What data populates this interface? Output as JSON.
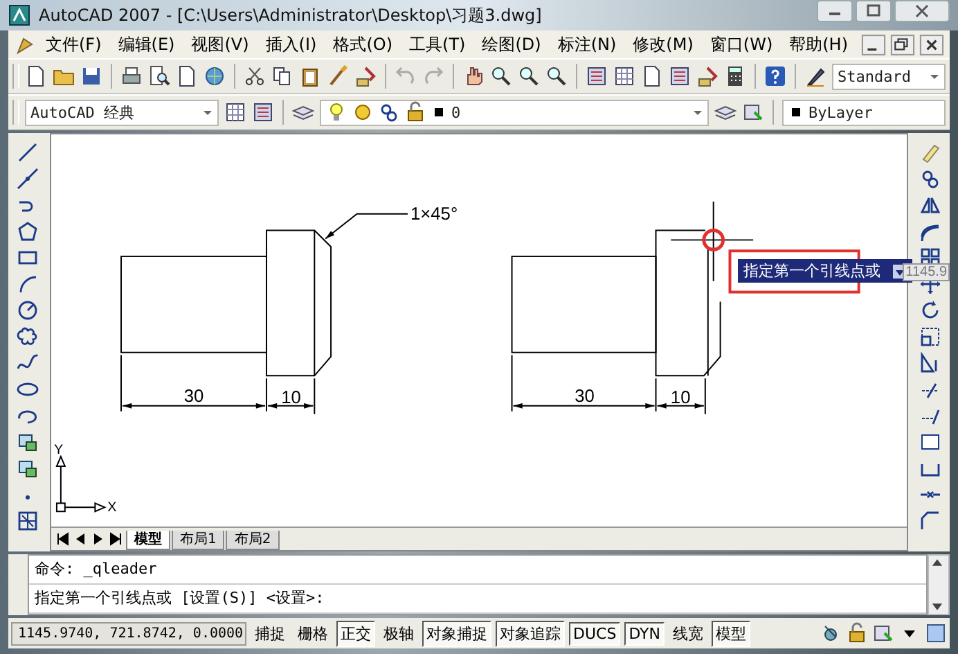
{
  "window": {
    "title": "AutoCAD 2007 - [C:\\Users\\Administrator\\Desktop\\习题3.dwg]"
  },
  "menu": [
    "文件(F)",
    "编辑(E)",
    "视图(V)",
    "插入(I)",
    "格式(O)",
    "工具(T)",
    "绘图(D)",
    "标注(N)",
    "修改(M)",
    "窗口(W)",
    "帮助(H)"
  ],
  "toolbar": {
    "text_style": "Standard"
  },
  "properties_bar": {
    "workspace": "AutoCAD 经典",
    "layer": "0",
    "color_setting": "ByLayer"
  },
  "drawing": {
    "left_part": {
      "length_dim": "30",
      "head_dim": "10",
      "chamfer_note": "1×45°"
    },
    "right_part": {
      "length_dim": "30",
      "head_dim": "10"
    },
    "prompt_tooltip": "指定第一个引线点或",
    "coordinate_tooltip": "1145.9",
    "ucs_y": "Y",
    "ucs_x": "X"
  },
  "layout_tabs": [
    {
      "label": "模型",
      "selected": true
    },
    {
      "label": "布局1",
      "selected": false
    },
    {
      "label": "布局2",
      "selected": false
    }
  ],
  "command_lines": [
    "命令: _qleader",
    "指定第一个引线点或 [设置(S)] <设置>:"
  ],
  "status_bar": {
    "coordinates": "1145.9740, 721.8742, 0.0000",
    "toggles": [
      {
        "label": "捕捉",
        "on": false
      },
      {
        "label": "栅格",
        "on": false
      },
      {
        "label": "正交",
        "on": true
      },
      {
        "label": "极轴",
        "on": false
      },
      {
        "label": "对象捕捉",
        "on": true
      },
      {
        "label": "对象追踪",
        "on": true
      },
      {
        "label": "DUCS",
        "on": true
      },
      {
        "label": "DYN",
        "on": true
      },
      {
        "label": "线宽",
        "on": false
      },
      {
        "label": "模型",
        "on": true
      }
    ]
  }
}
